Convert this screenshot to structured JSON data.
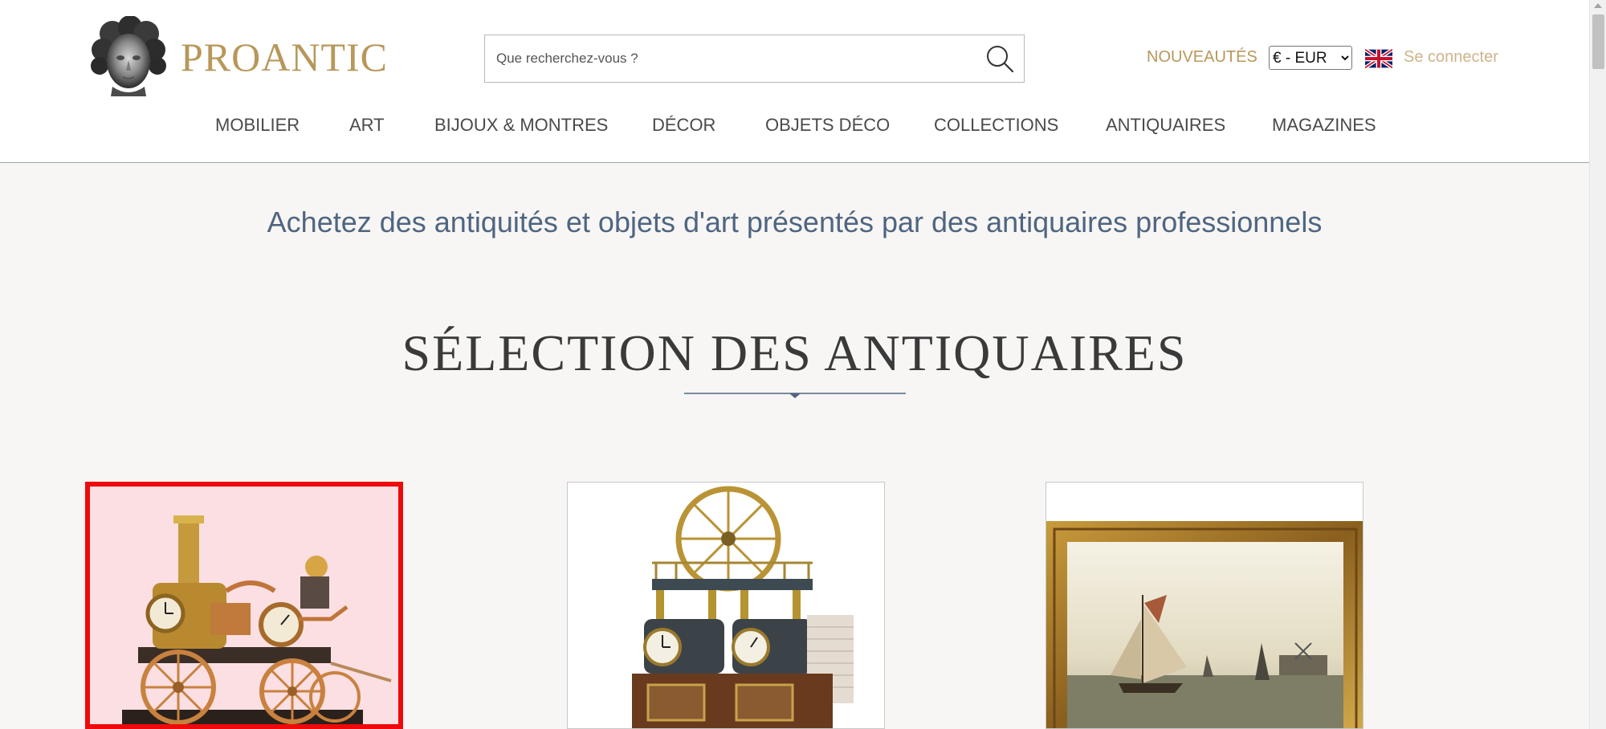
{
  "header": {
    "brand": "PROANTIC",
    "search": {
      "placeholder": "Que recherchez-vous ?",
      "value": ""
    },
    "nouveautes_label": "NOUVEAUTÉS",
    "currency": {
      "selected": "€ - EUR",
      "options": [
        "€ - EUR"
      ]
    },
    "language_flag": "uk-flag-icon",
    "login_label": "Se connecter"
  },
  "nav": {
    "items": [
      {
        "label": "MOBILIER"
      },
      {
        "label": "ART"
      },
      {
        "label": "BIJOUX & MONTRES"
      },
      {
        "label": "DÉCOR"
      },
      {
        "label": "OBJETS DÉCO"
      },
      {
        "label": "COLLECTIONS"
      },
      {
        "label": "ANTIQUAIRES"
      },
      {
        "label": "MAGAZINES"
      }
    ]
  },
  "main": {
    "tagline": "Achetez des antiquités et objets d'art présentés par des antiquaires professionnels",
    "section_title": "SÉLECTION DES ANTIQUAIRES",
    "cards": [
      {
        "image": "steam-fire-engine-clock",
        "selected": true
      },
      {
        "image": "steam-engine-clock",
        "selected": false
      },
      {
        "image": "framed-marine-painting",
        "selected": false
      }
    ]
  },
  "colors": {
    "brand_gold": "#b8975a",
    "tagline_blue": "#4f6581",
    "selection_red": "#ee0a0a",
    "background": "#f7f6f4"
  }
}
